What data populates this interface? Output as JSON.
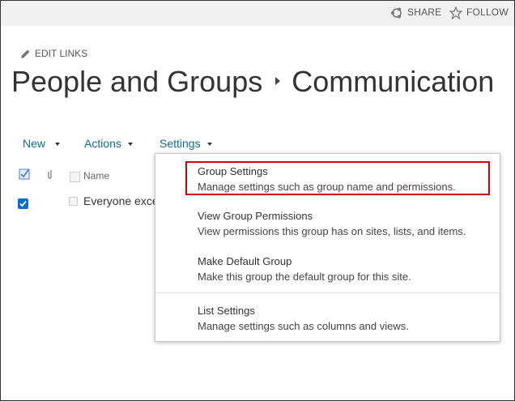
{
  "topbar": {
    "share_label": "SHARE",
    "follow_label": "FOLLOW"
  },
  "edit_links": "EDIT LINKS",
  "title": {
    "part1": "People and Groups",
    "part2": "Communication"
  },
  "toolbar": {
    "new_label": "New",
    "actions_label": "Actions",
    "settings_label": "Settings"
  },
  "list": {
    "name_header": "Name",
    "row_text": "Everyone exce"
  },
  "menu": {
    "items": [
      {
        "title": "Group Settings",
        "desc": "Manage settings such as group name and permissions."
      },
      {
        "title": "View Group Permissions",
        "desc": "View permissions this group has on sites, lists, and items."
      },
      {
        "title": "Make Default Group",
        "desc": "Make this group the default group for this site."
      },
      {
        "title": "List Settings",
        "desc": "Manage settings such as columns and views."
      }
    ]
  },
  "colors": {
    "accent_link": "#0f6b8a",
    "highlight_border": "#d40000",
    "checkbox_blue": "#0b6ec9"
  }
}
